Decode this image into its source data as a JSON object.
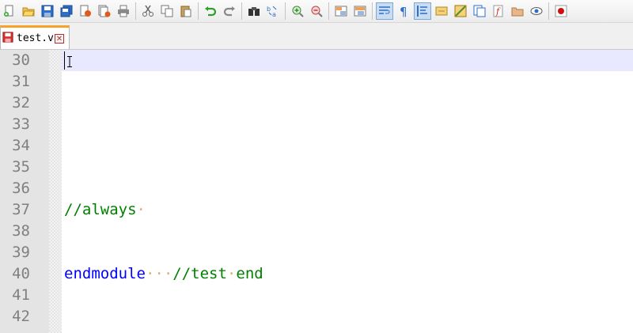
{
  "toolbar": {
    "icons": [
      "new-file",
      "open-file",
      "save",
      "save-all",
      "close",
      "close-all",
      "print",
      "cut",
      "copy",
      "paste",
      "undo",
      "redo",
      "find",
      "replace",
      "zoom-in",
      "zoom-out",
      "sync-vertical",
      "sync-horizontal",
      "word-wrap",
      "show-all-characters",
      "indent-guide",
      "user-defined-language",
      "document-map",
      "function-list",
      "folder-as-workspace",
      "monitoring",
      "record-macro"
    ]
  },
  "tab": {
    "filename": "test.v",
    "close_glyph": "✕"
  },
  "editor": {
    "lines": [
      {
        "num": "30"
      },
      {
        "num": "31"
      },
      {
        "num": "32"
      },
      {
        "num": "33"
      },
      {
        "num": "34"
      },
      {
        "num": "35"
      },
      {
        "num": "36"
      },
      {
        "num": "37",
        "comment": "//always",
        "trail": "·"
      },
      {
        "num": "38"
      },
      {
        "num": "39"
      },
      {
        "num": "40",
        "keyword": "endmodule",
        "ws1": "···",
        "comment": "//test",
        "ws2": "·",
        "comment2": "end"
      },
      {
        "num": "41"
      },
      {
        "num": "42"
      }
    ]
  },
  "colors": {
    "comment": "#008000",
    "keyword": "#0000ff",
    "current_line": "#e8e8ff",
    "gutter": "#e4e4e4",
    "tab_accent": "#f7a22a"
  }
}
